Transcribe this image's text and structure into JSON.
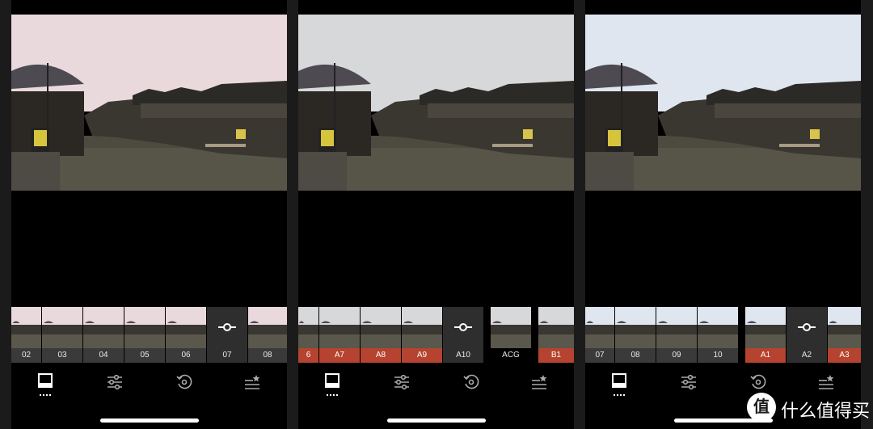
{
  "panels": [
    {
      "tint": "#ead9dc",
      "filters": [
        {
          "label": "02",
          "style": "normal"
        },
        {
          "label": "03",
          "style": "normal"
        },
        {
          "label": "04",
          "style": "normal"
        },
        {
          "label": "05",
          "style": "normal"
        },
        {
          "label": "06",
          "style": "normal"
        },
        {
          "label": "07",
          "style": "active"
        },
        {
          "label": "08",
          "style": "normal"
        }
      ]
    },
    {
      "tint": "#d7d8d9",
      "filters": [
        {
          "label": "6",
          "style": "red"
        },
        {
          "label": "A7",
          "style": "red"
        },
        {
          "label": "A8",
          "style": "red"
        },
        {
          "label": "A9",
          "style": "red"
        },
        {
          "label": "A10",
          "style": "active"
        },
        {
          "label": "ACG",
          "style": "black"
        },
        {
          "label": "B1",
          "style": "red"
        }
      ]
    },
    {
      "tint": "#dfe6ef",
      "filters": [
        {
          "label": "07",
          "style": "normal"
        },
        {
          "label": "08",
          "style": "normal"
        },
        {
          "label": "09",
          "style": "normal"
        },
        {
          "label": "10",
          "style": "normal"
        },
        {
          "label": "A1",
          "style": "red"
        },
        {
          "label": "A2",
          "style": "active"
        },
        {
          "label": "A3",
          "style": "red"
        }
      ]
    }
  ],
  "toolbar": {
    "icons": [
      "filters-icon",
      "adjust-sliders-icon",
      "history-icon",
      "presets-icon"
    ],
    "selected": "filters-icon"
  },
  "watermark": {
    "logo_text": "值",
    "text": "什么值得买"
  },
  "colors": {
    "accent_red": "#b5432f",
    "background": "#000000"
  }
}
